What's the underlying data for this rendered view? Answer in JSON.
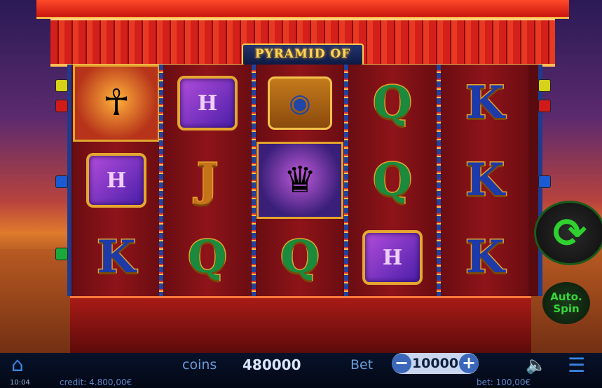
{
  "game": {
    "title": "PYRAMID OF LIGHT"
  },
  "reels": [
    [
      "pharaoh",
      "book",
      "K"
    ],
    [
      "book",
      "J",
      "Q"
    ],
    [
      "eye",
      "queen",
      "Q"
    ],
    [
      "Q",
      "Q",
      "book"
    ],
    [
      "K",
      "K",
      "K"
    ]
  ],
  "symbols": {
    "pharaoh_icon": "☥",
    "queen_icon": "♛",
    "eye_icon": "◉",
    "book_letter": "H"
  },
  "controls": {
    "spin_icon": "⟳",
    "auto_spin_label_1": "Auto.",
    "auto_spin_label_2": "Spin"
  },
  "bottom_bar": {
    "home_icon": "⌂",
    "time": "10:04",
    "credit": "credit: 4.800,00€",
    "coins_label": "coins",
    "coins_value": "480000",
    "bet_label": "Bet",
    "bet_minus": "−",
    "bet_value": "10000",
    "bet_plus": "+",
    "bet_amount": "bet: 100,00€",
    "sound_icon": "🔈",
    "menu_icon": "☰"
  },
  "colors": {
    "accent_green": "#2fd12f",
    "accent_blue": "#3a86e6"
  }
}
